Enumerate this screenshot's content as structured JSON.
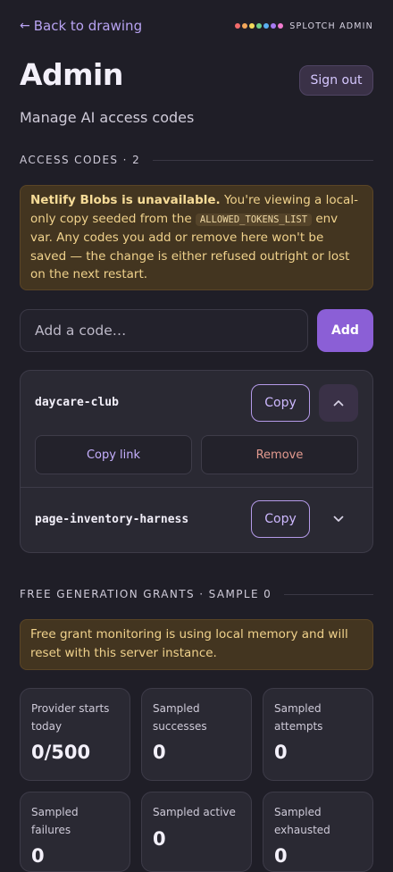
{
  "nav": {
    "back_label": "Back to drawing",
    "back_icon": "arrow-left-icon"
  },
  "brand": {
    "name": "SPLOTCH ADMIN",
    "dot_colors": [
      "#f26b6b",
      "#f2a65a",
      "#f2d95a",
      "#6ed08a",
      "#5ab0f2",
      "#a77bf2",
      "#f27bd0"
    ]
  },
  "header": {
    "title": "Admin",
    "sign_out_label": "Sign out",
    "subtitle": "Manage AI access codes"
  },
  "access_codes": {
    "section_label": "ACCESS CODES · 2",
    "warning": {
      "bold": "Netlify Blobs is unavailable.",
      "text_1": " You're viewing a local-only copy seeded from the ",
      "code": "ALLOWED_TOKENS_LIST",
      "text_2": " env var. Any codes you add or remove here won't be saved — the change is either refused outright or lost on the next restart."
    },
    "add_placeholder": "Add a code…",
    "add_label": "Add",
    "items": [
      {
        "code": "daycare-club",
        "copy_label": "Copy",
        "expanded": true,
        "copy_link_label": "Copy link",
        "remove_label": "Remove"
      },
      {
        "code": "page-inventory-harness",
        "copy_label": "Copy",
        "expanded": false
      }
    ]
  },
  "grants": {
    "section_label": "FREE GENERATION GRANTS · SAMPLE 0",
    "warning": "Free grant monitoring is using local memory and will reset with this server instance.",
    "stats": [
      {
        "label": "Provider starts today",
        "value": "0/500"
      },
      {
        "label": "Sampled successes",
        "value": "0"
      },
      {
        "label": "Sampled attempts",
        "value": "0"
      },
      {
        "label": "Sampled failures",
        "value": "0"
      },
      {
        "label": "Sampled active",
        "value": "0"
      },
      {
        "label": "Sampled exhausted",
        "value": "0"
      }
    ]
  },
  "colors": {
    "accent": "#8b5fd6",
    "background": "#1f1e27",
    "warning_bg": "#433520",
    "remove": "#e39a8f"
  }
}
